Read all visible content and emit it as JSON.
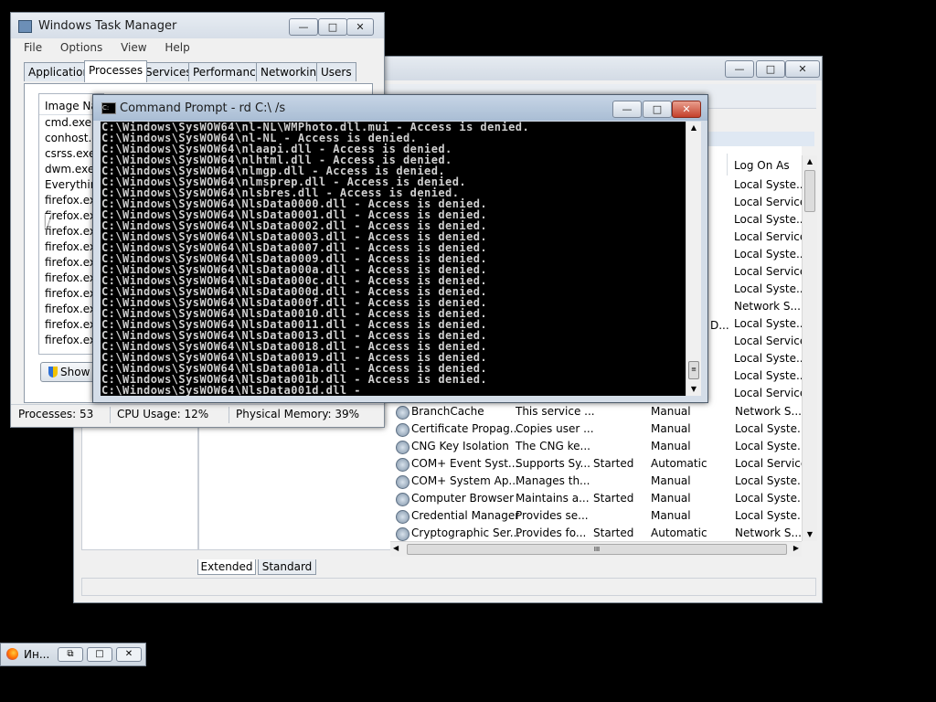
{
  "services_window": {
    "columns": {
      "logon": "Log On As"
    },
    "logon_column_top": [
      "Local Syste...",
      "Local Service",
      "Local Syste...",
      "Local Service",
      "Local Syste...",
      "Local Service",
      "Local Syste...",
      "Network S...",
      "Local Syste...",
      "Local Service",
      "Local Syste...",
      "Local Syste...",
      "Local Service"
    ],
    "rows": [
      {
        "name": "BranchCache",
        "desc": "This service ...",
        "status": "",
        "startup": "Manual",
        "logon": "Network S..."
      },
      {
        "name": "Certificate Propag...",
        "desc": "Copies user ...",
        "status": "",
        "startup": "Manual",
        "logon": "Local Syste..."
      },
      {
        "name": "CNG Key Isolation",
        "desc": "The CNG ke...",
        "status": "",
        "startup": "Manual",
        "logon": "Local Syste..."
      },
      {
        "name": "COM+ Event Syst...",
        "desc": "Supports Sy...",
        "status": "Started",
        "startup": "Automatic",
        "logon": "Local Service"
      },
      {
        "name": "COM+ System Ap...",
        "desc": "Manages th...",
        "status": "",
        "startup": "Manual",
        "logon": "Local Syste..."
      },
      {
        "name": "Computer Browser",
        "desc": "Maintains a...",
        "status": "Started",
        "startup": "Manual",
        "logon": "Local Syste..."
      },
      {
        "name": "Credential Manager",
        "desc": "Provides se...",
        "status": "",
        "startup": "Manual",
        "logon": "Local Syste..."
      },
      {
        "name": "Cryptographic Ser...",
        "desc": "Provides fo...",
        "status": "Started",
        "startup": "Automatic",
        "logon": "Network S..."
      }
    ],
    "stray_text": "D...",
    "hscroll_grip": "III",
    "tabs": [
      "Extended",
      "Standard"
    ]
  },
  "task_manager": {
    "title": "Windows Task Manager",
    "menu": [
      "File",
      "Options",
      "View",
      "Help"
    ],
    "tabs": [
      "Applications",
      "Processes",
      "Services",
      "Performance",
      "Networking",
      "Users"
    ],
    "column_header": "Image Nam",
    "processes": [
      "cmd.exe",
      "conhost.exe",
      "csrss.exe",
      "dwm.exe",
      "Everything",
      "firefox.exe",
      "firefox.exe",
      "firefox.exe",
      "firefox.exe",
      "firefox.exe",
      "firefox.exe",
      "firefox.exe",
      "firefox.exe",
      "firefox.exe",
      "firefox.exe"
    ],
    "show_button": "Show p",
    "status": {
      "processes": "Processes: 53",
      "cpu": "CPU Usage: 12%",
      "memory": "Physical Memory: 39%"
    }
  },
  "cmd": {
    "title": "Command Prompt - rd  C:\\ /s",
    "lines": [
      "C:\\Windows\\SysWOW64\\nl-NL\\WMPhoto.dll.mui - Access is denied.",
      "C:\\Windows\\SysWOW64\\nl-NL - Access is denied.",
      "C:\\Windows\\SysWOW64\\nlaapi.dll - Access is denied.",
      "C:\\Windows\\SysWOW64\\nlhtml.dll - Access is denied.",
      "C:\\Windows\\SysWOW64\\nlmgp.dll - Access is denied.",
      "C:\\Windows\\SysWOW64\\nlmsprep.dll - Access is denied.",
      "C:\\Windows\\SysWOW64\\nlsbres.dll - Access is denied.",
      "C:\\Windows\\SysWOW64\\NlsData0000.dll - Access is denied.",
      "C:\\Windows\\SysWOW64\\NlsData0001.dll - Access is denied.",
      "C:\\Windows\\SysWOW64\\NlsData0002.dll - Access is denied.",
      "C:\\Windows\\SysWOW64\\NlsData0003.dll - Access is denied.",
      "C:\\Windows\\SysWOW64\\NlsData0007.dll - Access is denied.",
      "C:\\Windows\\SysWOW64\\NlsData0009.dll - Access is denied.",
      "C:\\Windows\\SysWOW64\\NlsData000a.dll - Access is denied.",
      "C:\\Windows\\SysWOW64\\NlsData000c.dll - Access is denied.",
      "C:\\Windows\\SysWOW64\\NlsData000d.dll - Access is denied.",
      "C:\\Windows\\SysWOW64\\NlsData000f.dll - Access is denied.",
      "C:\\Windows\\SysWOW64\\NlsData0010.dll - Access is denied.",
      "C:\\Windows\\SysWOW64\\NlsData0011.dll - Access is denied.",
      "C:\\Windows\\SysWOW64\\NlsData0013.dll - Access is denied.",
      "C:\\Windows\\SysWOW64\\NlsData0018.dll - Access is denied.",
      "C:\\Windows\\SysWOW64\\NlsData0019.dll - Access is denied.",
      "C:\\Windows\\SysWOW64\\NlsData001a.dll - Access is denied.",
      "C:\\Windows\\SysWOW64\\NlsData001b.dll - Access is denied.",
      "C:\\Windows\\SysWOW64\\NlsData001d.dll -"
    ]
  },
  "minimized": {
    "label": "Ин..."
  },
  "icons": {
    "cmd": "cmd-icon",
    "firefox": "firefox-icon",
    "shield": "shield-icon",
    "service": "service-gear-icon"
  }
}
